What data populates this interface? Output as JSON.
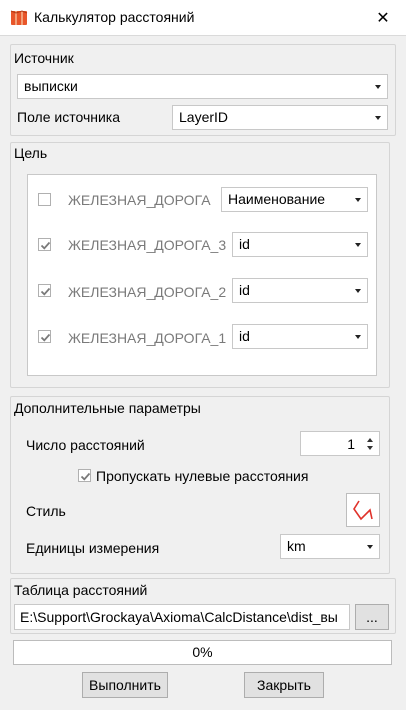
{
  "window": {
    "title": "Калькулятор расстояний",
    "close_glyph": "✕"
  },
  "source": {
    "group_title": "Источник",
    "table_value": "выписки",
    "field_label": "Поле источника",
    "field_value": "LayerID"
  },
  "target": {
    "group_title": "Цель",
    "rows": [
      {
        "name": "ЖЕЛЕЗНАЯ_ДОРОГА",
        "checked": false,
        "field": "Наименование"
      },
      {
        "name": "ЖЕЛЕЗНАЯ_ДОРОГА_3",
        "checked": true,
        "field": "id"
      },
      {
        "name": "ЖЕЛЕЗНАЯ_ДОРОГА_2",
        "checked": true,
        "field": "id"
      },
      {
        "name": "ЖЕЛЕЗНАЯ_ДОРОГА_1",
        "checked": true,
        "field": "id"
      }
    ]
  },
  "params": {
    "group_title": "Дополнительные параметры",
    "count_label": "Число расстояний",
    "count_value": "1",
    "skip_zero_label": "Пропускать нулевые расстояния",
    "skip_zero_checked": true,
    "style_label": "Стиль",
    "style_icon": "polyline-style-icon",
    "style_color": "#e0322b",
    "units_label": "Единицы измерения",
    "units_value": "km"
  },
  "output": {
    "group_title": "Таблица расстояний",
    "path": "E:\\Support\\Grockaya\\Axioma\\CalcDistance\\dist_вы",
    "browse_label": "..."
  },
  "progress": {
    "percent": 0,
    "text": "0%"
  },
  "buttons": {
    "run": "Выполнить",
    "close": "Закрыть"
  }
}
